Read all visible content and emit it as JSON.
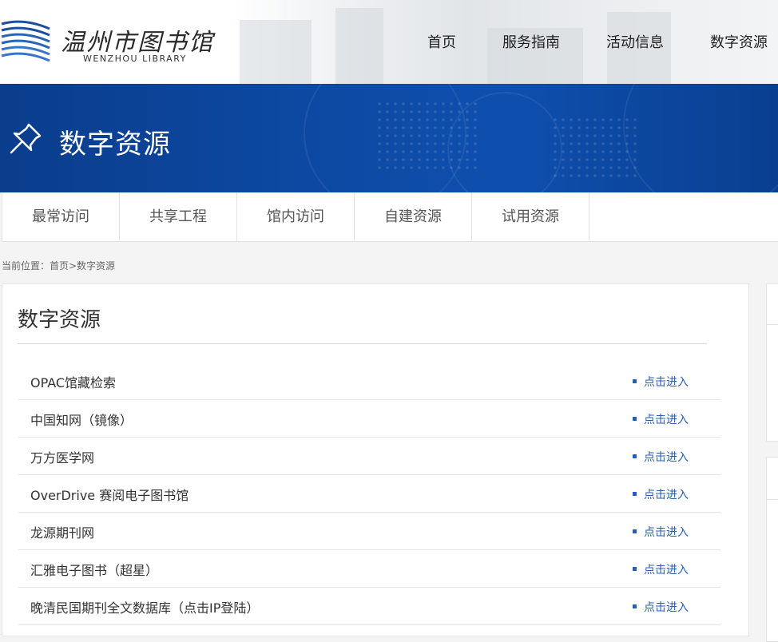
{
  "header": {
    "logo_cn": "温州市图书馆",
    "logo_en": "WENZHOU LIBRARY",
    "nav": [
      "首页",
      "服务指南",
      "活动信息",
      "数字资源"
    ]
  },
  "banner": {
    "title": "数字资源",
    "icon": "pushpin-icon"
  },
  "subtabs": [
    "最常访问",
    "共享工程",
    "馆内访问",
    "自建资源",
    "试用资源"
  ],
  "breadcrumb": "当前位置：首页>数字资源",
  "panel": {
    "title": "数字资源",
    "items": [
      {
        "name": "OPAC馆藏检索",
        "link": "点击进入"
      },
      {
        "name": "中国知网（镜像）",
        "link": "点击进入"
      },
      {
        "name": "万方医学网",
        "link": "点击进入"
      },
      {
        "name": "OverDrive 赛阅电子图书馆",
        "link": "点击进入"
      },
      {
        "name": "龙源期刊网",
        "link": "点击进入"
      },
      {
        "name": "汇雅电子图书（超星）",
        "link": "点击进入"
      },
      {
        "name": "晚清民国期刊全文数据库（点击IP登陆）",
        "link": "点击进入"
      }
    ]
  },
  "colors": {
    "banner_blue": "#0d49a3",
    "link_blue": "#2a5db0"
  }
}
